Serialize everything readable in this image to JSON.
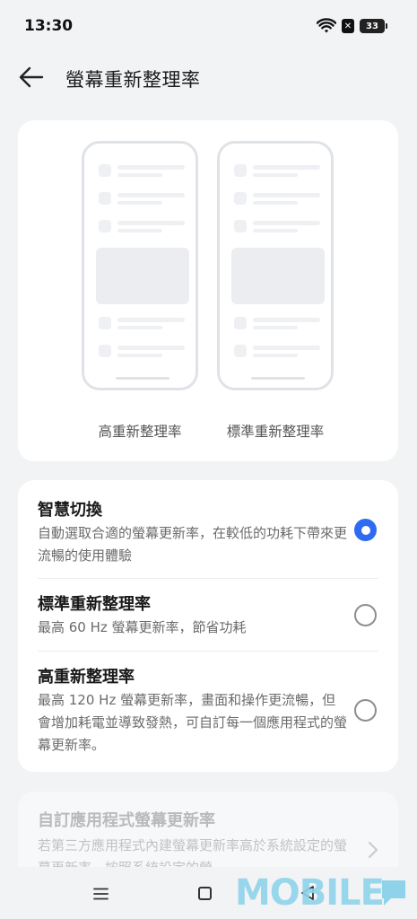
{
  "status_bar": {
    "time": "13:30",
    "battery": "33",
    "icons": [
      "wifi-icon",
      "sim-x-icon",
      "battery-icon"
    ]
  },
  "header": {
    "title": "螢幕重新整理率",
    "back_icon": "arrow-left-icon"
  },
  "preview": {
    "high_label": "高重新整理率",
    "standard_label": "標準重新整理率"
  },
  "options": {
    "smart": {
      "title": "智慧切換",
      "desc": "自動選取合適的螢幕更新率，在較低的功耗下帶來更流暢的使用體驗",
      "selected": true
    },
    "standard": {
      "title": "標準重新整理率",
      "desc": "最高 60 Hz 螢幕更新率，節省功耗",
      "selected": false
    },
    "high": {
      "title": "高重新整理率",
      "desc": "最高 120 Hz 螢幕更新率，畫面和操作更流暢，但會增加耗電並導致發熱，可自訂每一個應用程式的螢幕更新率。",
      "selected": false
    }
  },
  "custom": {
    "title": "自訂應用程式螢幕更新率",
    "desc": "若第三方應用程式內建螢幕更新率高於系統設定的螢幕更新率，按照系統設定的螢",
    "enabled": false
  },
  "watermark": "MOBILE",
  "colors": {
    "accent": "#2f6bf0",
    "background": "#f2f3f5",
    "watermark": "#8fd3ea"
  }
}
